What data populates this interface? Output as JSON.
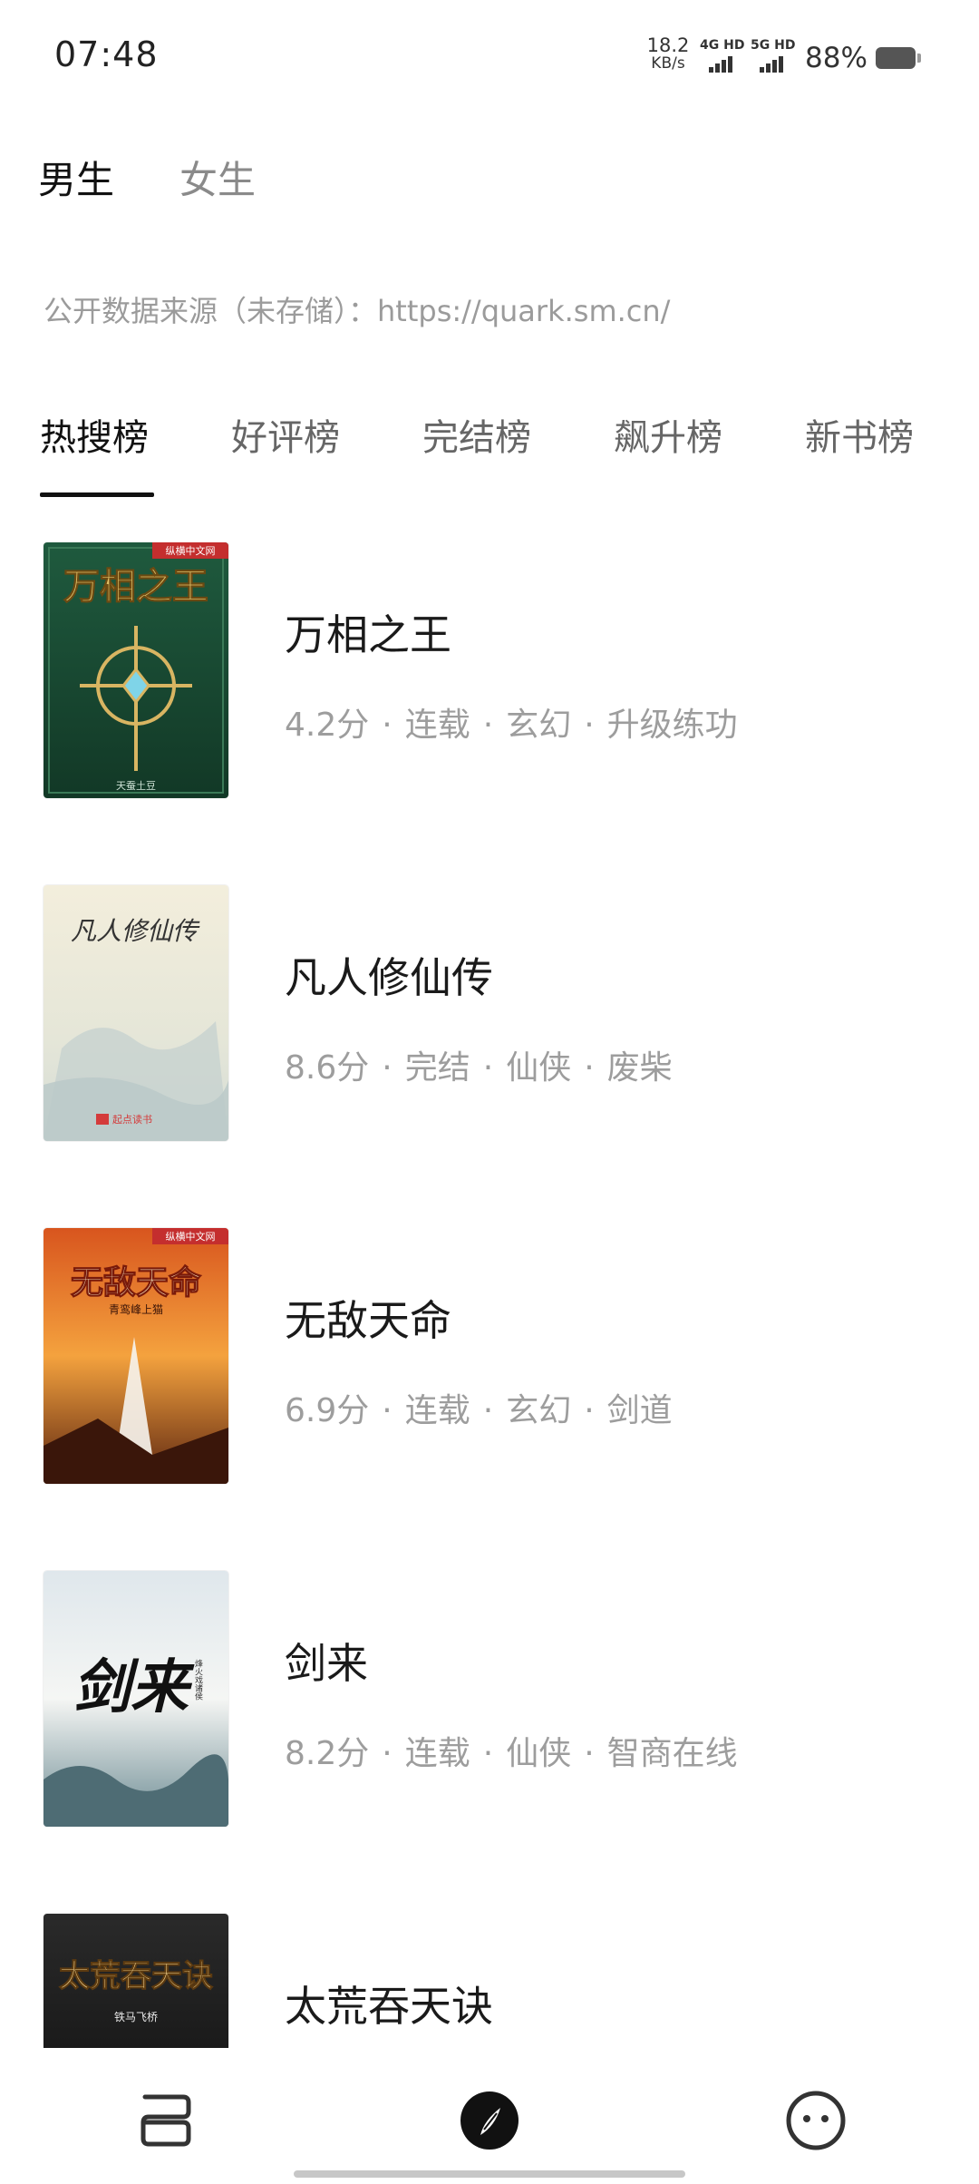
{
  "status_bar": {
    "time": "07:48",
    "net_speed_value": "18.2",
    "net_speed_unit": "KB/s",
    "sim1_label": "4G HD",
    "sim2_label": "5G HD",
    "battery_percent": "88%"
  },
  "gender_tabs": {
    "male": "男生",
    "female": "女生"
  },
  "data_source": "公开数据来源（未存储）：https://quark.sm.cn/",
  "rank_tabs": [
    {
      "label": "热搜榜"
    },
    {
      "label": "好评榜"
    },
    {
      "label": "完结榜"
    },
    {
      "label": "飙升榜"
    },
    {
      "label": "新书榜"
    }
  ],
  "books": [
    {
      "title": "万相之王",
      "score": "4.2分",
      "status": "连载",
      "genre": "玄幻",
      "tag": "升级练功",
      "cover_title": "万相之王",
      "cover_publisher": "纵横中文网",
      "cover_author": "天蚕土豆"
    },
    {
      "title": "凡人修仙传",
      "score": "8.6分",
      "status": "完结",
      "genre": "仙侠",
      "tag": "废柴",
      "cover_title": "凡人修仙传",
      "cover_publisher": "起点读书"
    },
    {
      "title": "无敌天命",
      "score": "6.9分",
      "status": "连载",
      "genre": "玄幻",
      "tag": "剑道",
      "cover_title": "无敌天命",
      "cover_publisher": "纵横中文网",
      "cover_author": "青鸾峰上猫"
    },
    {
      "title": "剑来",
      "score": "8.2分",
      "status": "连载",
      "genre": "仙侠",
      "tag": "智商在线",
      "cover_title": "剑来",
      "cover_author": "烽火戏诸侯"
    },
    {
      "title": "太荒吞天诀",
      "cover_title": "太荒吞天诀",
      "cover_author": "铁马飞桥"
    }
  ],
  "colors": {
    "text_primary": "#1a1a1a",
    "text_secondary": "#9d9d9d",
    "accent": "#111111"
  },
  "bottom_nav": [
    {
      "icon": "bookshelf-icon"
    },
    {
      "icon": "compass-icon"
    },
    {
      "icon": "face-icon"
    }
  ]
}
